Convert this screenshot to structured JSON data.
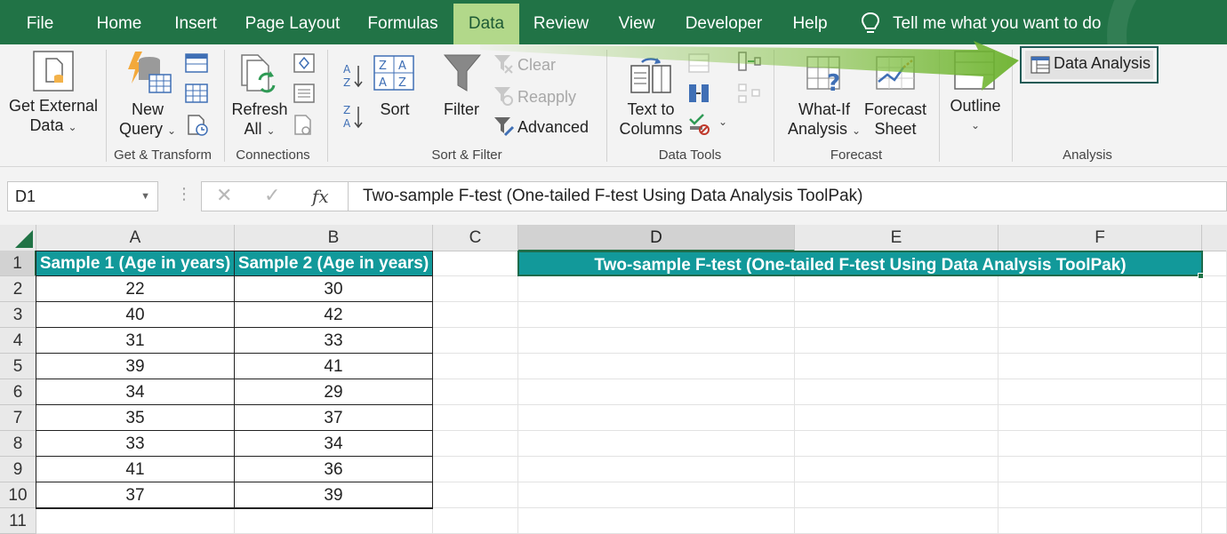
{
  "menu": {
    "tabs": [
      "File",
      "Home",
      "Insert",
      "Page Layout",
      "Formulas",
      "Data",
      "Review",
      "View",
      "Developer",
      "Help"
    ],
    "active_tab": "Data",
    "tell_me": "Tell me what you want to do"
  },
  "ribbon": {
    "get_external_data": {
      "line1": "Get External",
      "line2": "Data"
    },
    "new_query": {
      "line1": "New",
      "line2": "Query"
    },
    "group_get_transform": "Get & Transform",
    "refresh_all": {
      "line1": "Refresh",
      "line2": "All"
    },
    "group_connections": "Connections",
    "sort": "Sort",
    "filter": "Filter",
    "clear": "Clear",
    "reapply": "Reapply",
    "advanced": "Advanced",
    "group_sort_filter": "Sort & Filter",
    "text_to_columns": {
      "line1": "Text to",
      "line2": "Columns"
    },
    "group_data_tools": "Data Tools",
    "what_if": {
      "line1": "What-If",
      "line2": "Analysis"
    },
    "forecast_sheet": {
      "line1": "Forecast",
      "line2": "Sheet"
    },
    "group_forecast": "Forecast",
    "outline": "Outline",
    "data_analysis": "Data Analysis",
    "group_analysis": "Analysis"
  },
  "formula_bar": {
    "name_box": "D1",
    "fx": "fx",
    "formula": "Two-sample F-test (One-tailed F-test Using Data Analysis ToolPak)"
  },
  "sheet": {
    "columns": [
      "A",
      "B",
      "C",
      "D",
      "E",
      "F"
    ],
    "selected_column": "D",
    "rows": [
      "1",
      "2",
      "3",
      "4",
      "5",
      "6",
      "7",
      "8",
      "9",
      "10",
      "11"
    ],
    "selected_row": "1",
    "table": {
      "headers": [
        "Sample 1 (Age in years)",
        "Sample 2 (Age in years)"
      ],
      "data": [
        [
          22,
          30
        ],
        [
          40,
          42
        ],
        [
          31,
          33
        ],
        [
          39,
          41
        ],
        [
          34,
          29
        ],
        [
          35,
          37
        ],
        [
          33,
          34
        ],
        [
          41,
          36
        ],
        [
          37,
          39
        ]
      ]
    },
    "d1_title": "Two-sample F-test (One-tailed F-test Using Data Analysis ToolPak)"
  },
  "colors": {
    "excel_green": "#217346",
    "active_tab_bg": "#b2d88a",
    "teal_header": "#12999a",
    "highlight_arrow": "#7dbf3a"
  }
}
